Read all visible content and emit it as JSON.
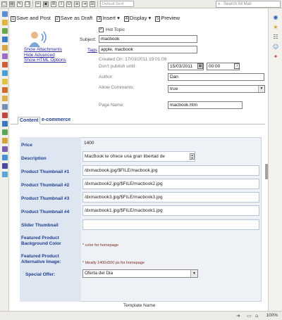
{
  "toolbar": {
    "style_select": "Default Serif",
    "search_placeholder": "Search All Mail"
  },
  "actions": [
    {
      "num": "1",
      "label": "Save and Post"
    },
    {
      "num": "2",
      "label": "Save as Draft"
    },
    {
      "num": "3",
      "label": "Insert"
    },
    {
      "num": "4",
      "label": "Display"
    },
    {
      "num": "5",
      "label": "Preview"
    }
  ],
  "info_links": [
    "Show Attachments",
    "Hide Advanced",
    "Show HTML Options"
  ],
  "properties": {
    "hot_topic_label": "Hot Topic",
    "hot_topic_checked": true,
    "subject_label": "Subject:",
    "subject_value": "macbook",
    "tags_label": "Tags",
    "tags_value": "apple, macbook",
    "created_label": "Created On: 17/03/2011 19:01:09",
    "dont_publish_label": "Don't publish until:",
    "publish_date": "15/03/2011",
    "publish_time": "00:00",
    "author_label": "Author:",
    "author_value": "Dan",
    "allow_comments_label": "Allow Comments:",
    "allow_comments_value": "true",
    "page_name_label": "Page Name:",
    "page_name_value": "macbook.htm"
  },
  "tabs": [
    "Content",
    "e-commerce"
  ],
  "form": {
    "price_label": "Price",
    "price_value": "1400",
    "description_label": "Description",
    "description_value": "MacBook te ofrece una gran libertad de",
    "thumb1_label": "Product Thumbnail #1",
    "thumb1_value": "/dxmacbook.jpg/$FILE/macbook.jpg",
    "thumb2_label": "Product Thumbnail #2",
    "thumb2_value": "/dxmacbook2.jpg/$FILE/macbook2.jpg",
    "thumb3_label": "Product Thumbnail #3",
    "thumb3_value": "/dxmacbook3.jpg/$FILE/macbook3.jpg",
    "thumb4_label": "Product Thumbnail #4",
    "thumb4_value": "/dxmacbook1.jpg/$FILE/macbook1.jpg",
    "slider_label": "Slider Thumbnail",
    "slider_value": "",
    "bg_color_label_1": "Featured Product",
    "bg_color_label_2": "Background Color",
    "bg_color_hint": "* color for homepage",
    "alt_image_label_1": "Featured Product",
    "alt_image_label_2": "Alternative Image:",
    "alt_image_hint": "* Ideally 1400x500 px for homepage",
    "special_offer_label": "Special Offer:",
    "special_offer_value": "Oferta del Dia"
  },
  "template_name_label": "Template Name",
  "status": {
    "zoom": "100%"
  },
  "colors": {
    "label_blue": "#1f3f8f",
    "label_bg": "#dde6f1",
    "hint_red": "#7b2c1a"
  }
}
